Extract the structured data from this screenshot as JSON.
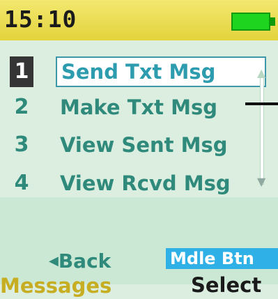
{
  "status": {
    "time": "15:10",
    "battery_icon": "battery-full-icon"
  },
  "menu": {
    "items": [
      {
        "number": "1",
        "label": "Send Txt Msg",
        "selected": true
      },
      {
        "number": "2",
        "label": "Make Txt Msg",
        "selected": false
      },
      {
        "number": "3",
        "label": "View Sent Msg",
        "selected": false
      },
      {
        "number": "4",
        "label": "View Rcvd Msg",
        "selected": false
      }
    ]
  },
  "softkeys": {
    "back_arrow": "◀",
    "back_label": "Back",
    "middle_label": "Mdle Btn",
    "left_label": "Messages",
    "right_label": "Select"
  },
  "colors": {
    "accent": "#2f8a7c",
    "highlight": "#2fb0e6",
    "status_bar": "#e3d33c",
    "left_softkey": "#c6ad22"
  }
}
